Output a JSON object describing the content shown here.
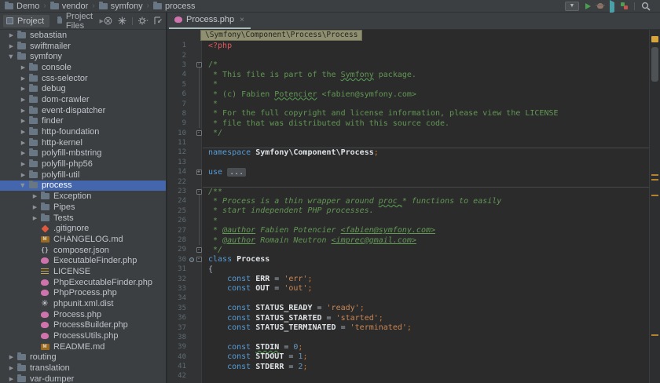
{
  "colors": {
    "selection": "#4466ad",
    "tab_underline": "#a8babb",
    "warning_stripe": "#b5832f",
    "inspection_indicator": "#d9a63d",
    "editor_bg": "#2b2b2b",
    "panel_bg": "#3c3f41"
  },
  "toolbar": {
    "breadcrumbs": [
      {
        "label": "Demo"
      },
      {
        "label": "vendor"
      },
      {
        "label": "symfony"
      },
      {
        "label": "process"
      }
    ],
    "icons": [
      "window-list-dropdown",
      "run",
      "debug",
      "run-with-coverage",
      "profiler",
      "search"
    ]
  },
  "project_panel": {
    "tab_project": "Project",
    "tab_project_files": "Project Files",
    "header_icons": [
      "collapse-all",
      "locate",
      "settings",
      "hide"
    ],
    "tree": [
      {
        "label": "sebastian",
        "type": "folder",
        "depth": 1,
        "arrow": "collapsed"
      },
      {
        "label": "swiftmailer",
        "type": "folder",
        "depth": 1,
        "arrow": "collapsed"
      },
      {
        "label": "symfony",
        "type": "folder",
        "depth": 1,
        "arrow": "expanded"
      },
      {
        "label": "console",
        "type": "folder",
        "depth": 2,
        "arrow": "collapsed"
      },
      {
        "label": "css-selector",
        "type": "folder",
        "depth": 2,
        "arrow": "collapsed"
      },
      {
        "label": "debug",
        "type": "folder",
        "depth": 2,
        "arrow": "collapsed"
      },
      {
        "label": "dom-crawler",
        "type": "folder",
        "depth": 2,
        "arrow": "collapsed"
      },
      {
        "label": "event-dispatcher",
        "type": "folder",
        "depth": 2,
        "arrow": "collapsed"
      },
      {
        "label": "finder",
        "type": "folder",
        "depth": 2,
        "arrow": "collapsed"
      },
      {
        "label": "http-foundation",
        "type": "folder",
        "depth": 2,
        "arrow": "collapsed"
      },
      {
        "label": "http-kernel",
        "type": "folder",
        "depth": 2,
        "arrow": "collapsed"
      },
      {
        "label": "polyfill-mbstring",
        "type": "folder",
        "depth": 2,
        "arrow": "collapsed"
      },
      {
        "label": "polyfill-php56",
        "type": "folder",
        "depth": 2,
        "arrow": "collapsed"
      },
      {
        "label": "polyfill-util",
        "type": "folder",
        "depth": 2,
        "arrow": "collapsed"
      },
      {
        "label": "process",
        "type": "folder",
        "depth": 2,
        "arrow": "expanded",
        "selected": true
      },
      {
        "label": "Exception",
        "type": "folder",
        "depth": 3,
        "arrow": "collapsed"
      },
      {
        "label": "Pipes",
        "type": "folder",
        "depth": 3,
        "arrow": "collapsed"
      },
      {
        "label": "Tests",
        "type": "folder",
        "depth": 3,
        "arrow": "collapsed"
      },
      {
        "label": ".gitignore",
        "type": "git",
        "depth": 3
      },
      {
        "label": "CHANGELOG.md",
        "type": "md",
        "depth": 3
      },
      {
        "label": "composer.json",
        "type": "json",
        "depth": 3
      },
      {
        "label": "ExecutableFinder.php",
        "type": "php",
        "depth": 3
      },
      {
        "label": "LICENSE",
        "type": "license",
        "depth": 3
      },
      {
        "label": "PhpExecutableFinder.php",
        "type": "php",
        "depth": 3
      },
      {
        "label": "PhpProcess.php",
        "type": "php",
        "depth": 3
      },
      {
        "label": "phpunit.xml.dist",
        "type": "xml",
        "depth": 3
      },
      {
        "label": "Process.php",
        "type": "php",
        "depth": 3
      },
      {
        "label": "ProcessBuilder.php",
        "type": "php",
        "depth": 3
      },
      {
        "label": "ProcessUtils.php",
        "type": "php",
        "depth": 3
      },
      {
        "label": "README.md",
        "type": "md",
        "depth": 3
      },
      {
        "label": "routing",
        "type": "folder",
        "depth": 1,
        "arrow": "collapsed"
      },
      {
        "label": "translation",
        "type": "folder",
        "depth": 1,
        "arrow": "collapsed"
      },
      {
        "label": "var-dumper",
        "type": "folder",
        "depth": 1,
        "arrow": "collapsed"
      }
    ]
  },
  "editor": {
    "tab": {
      "label": "Process.php",
      "close": "×"
    },
    "context": "\\Symfony\\Component\\Process\\Process",
    "lines": [
      {
        "num": "1",
        "segs": [
          {
            "t": "<?php",
            "c": "php"
          }
        ]
      },
      {
        "num": "2",
        "segs": []
      },
      {
        "num": "3",
        "fold": "-",
        "segs": [
          {
            "t": "/*",
            "c": "cmt"
          }
        ]
      },
      {
        "num": "4",
        "segs": [
          {
            "t": " * This file is part of the ",
            "c": "cmt"
          },
          {
            "t": "Symfony",
            "c": "cmt",
            "w": 1
          },
          {
            "t": " package.",
            "c": "cmt"
          }
        ]
      },
      {
        "num": "5",
        "segs": [
          {
            "t": " *",
            "c": "cmt"
          }
        ]
      },
      {
        "num": "6",
        "segs": [
          {
            "t": " * (c) Fabien ",
            "c": "cmt"
          },
          {
            "t": "Potencier",
            "c": "cmt",
            "w": 1
          },
          {
            "t": " <fabien@symfony.com>",
            "c": "cmt"
          }
        ]
      },
      {
        "num": "7",
        "segs": [
          {
            "t": " *",
            "c": "cmt"
          }
        ]
      },
      {
        "num": "8",
        "segs": [
          {
            "t": " * For the full copyright and license information, please view the LICENSE",
            "c": "cmt"
          }
        ]
      },
      {
        "num": "9",
        "segs": [
          {
            "t": " * file that was distributed with this source code.",
            "c": "cmt"
          }
        ]
      },
      {
        "num": "10",
        "fold": "-",
        "segs": [
          {
            "t": " */",
            "c": "cmt"
          }
        ]
      },
      {
        "num": "11",
        "segs": [],
        "sep_below": true
      },
      {
        "num": "12",
        "segs": [
          {
            "t": "namespace ",
            "c": "kw"
          },
          {
            "t": "Symfony\\Component\\Process",
            "c": "ns"
          },
          {
            "t": ";",
            "c": "semi"
          }
        ]
      },
      {
        "num": "13",
        "segs": []
      },
      {
        "num": "14",
        "fold": "+",
        "segs": [
          {
            "t": "use ",
            "c": "kw"
          },
          {
            "t": "...",
            "c": "fold"
          }
        ]
      },
      {
        "num": "22",
        "segs": [],
        "sep_below": true
      },
      {
        "num": "23",
        "fold": "-",
        "segs": [
          {
            "t": "/**",
            "c": "doc"
          }
        ]
      },
      {
        "num": "24",
        "segs": [
          {
            "t": " * Process is a thin wrapper around ",
            "c": "doc"
          },
          {
            "t": "proc_",
            "c": "doc",
            "w": 1
          },
          {
            "t": "* functions to easily",
            "c": "doc"
          }
        ]
      },
      {
        "num": "25",
        "segs": [
          {
            "t": " * start independent PHP processes.",
            "c": "doc"
          }
        ]
      },
      {
        "num": "26",
        "segs": [
          {
            "t": " *",
            "c": "doc"
          }
        ]
      },
      {
        "num": "27",
        "segs": [
          {
            "t": " * ",
            "c": "doc"
          },
          {
            "t": "@author",
            "c": "doc",
            "u": 1
          },
          {
            "t": " Fabien Potencier ",
            "c": "doc"
          },
          {
            "t": "<fabien@symfony.com>",
            "c": "doc",
            "u": 1
          }
        ]
      },
      {
        "num": "28",
        "segs": [
          {
            "t": " * ",
            "c": "doc"
          },
          {
            "t": "@author",
            "c": "doc",
            "u": 1
          },
          {
            "t": " Romain Neutron ",
            "c": "doc"
          },
          {
            "t": "<imprec@gmail.com>",
            "c": "doc",
            "u": 1
          }
        ]
      },
      {
        "num": "29",
        "fold": "-",
        "segs": [
          {
            "t": " */",
            "c": "doc"
          }
        ]
      },
      {
        "num": "30",
        "fold": "-",
        "icon": "class",
        "segs": [
          {
            "t": "class ",
            "c": "kw"
          },
          {
            "t": "Process",
            "c": "ns"
          }
        ]
      },
      {
        "num": "31",
        "segs": [
          {
            "t": "{",
            "c": "pl"
          }
        ]
      },
      {
        "num": "32",
        "segs": [
          {
            "t": "    ",
            "c": "pl"
          },
          {
            "t": "const ",
            "c": "kw"
          },
          {
            "t": "ERR",
            "c": "const"
          },
          {
            "t": " = ",
            "c": "pl"
          },
          {
            "t": "'err'",
            "c": "str"
          },
          {
            "t": ";",
            "c": "semi"
          }
        ]
      },
      {
        "num": "33",
        "segs": [
          {
            "t": "    ",
            "c": "pl"
          },
          {
            "t": "const ",
            "c": "kw"
          },
          {
            "t": "OUT",
            "c": "const"
          },
          {
            "t": " = ",
            "c": "pl"
          },
          {
            "t": "'out'",
            "c": "str"
          },
          {
            "t": ";",
            "c": "semi"
          }
        ]
      },
      {
        "num": "34",
        "segs": []
      },
      {
        "num": "35",
        "segs": [
          {
            "t": "    ",
            "c": "pl"
          },
          {
            "t": "const ",
            "c": "kw"
          },
          {
            "t": "STATUS_READY",
            "c": "const"
          },
          {
            "t": " = ",
            "c": "pl"
          },
          {
            "t": "'ready'",
            "c": "str"
          },
          {
            "t": ";",
            "c": "semi"
          }
        ]
      },
      {
        "num": "36",
        "segs": [
          {
            "t": "    ",
            "c": "pl"
          },
          {
            "t": "const ",
            "c": "kw"
          },
          {
            "t": "STATUS_STARTED",
            "c": "const"
          },
          {
            "t": " = ",
            "c": "pl"
          },
          {
            "t": "'started'",
            "c": "str"
          },
          {
            "t": ";",
            "c": "semi"
          }
        ]
      },
      {
        "num": "37",
        "segs": [
          {
            "t": "    ",
            "c": "pl"
          },
          {
            "t": "const ",
            "c": "kw"
          },
          {
            "t": "STATUS_TERMINATED",
            "c": "const"
          },
          {
            "t": " = ",
            "c": "pl"
          },
          {
            "t": "'terminated'",
            "c": "str"
          },
          {
            "t": ";",
            "c": "semi"
          }
        ]
      },
      {
        "num": "38",
        "segs": []
      },
      {
        "num": "39",
        "segs": [
          {
            "t": "    ",
            "c": "pl"
          },
          {
            "t": "const ",
            "c": "kw"
          },
          {
            "t": "STDIN",
            "c": "const",
            "w": 1
          },
          {
            "t": " = ",
            "c": "pl"
          },
          {
            "t": "0",
            "c": "num"
          },
          {
            "t": ";",
            "c": "semi"
          }
        ]
      },
      {
        "num": "40",
        "segs": [
          {
            "t": "    ",
            "c": "pl"
          },
          {
            "t": "const ",
            "c": "kw"
          },
          {
            "t": "STDOUT",
            "c": "const"
          },
          {
            "t": " = ",
            "c": "pl"
          },
          {
            "t": "1",
            "c": "num"
          },
          {
            "t": ";",
            "c": "semi"
          }
        ]
      },
      {
        "num": "41",
        "segs": [
          {
            "t": "    ",
            "c": "pl"
          },
          {
            "t": "const ",
            "c": "kw"
          },
          {
            "t": "STDERR",
            "c": "const"
          },
          {
            "t": " = ",
            "c": "pl"
          },
          {
            "t": "2",
            "c": "num"
          },
          {
            "t": ";",
            "c": "semi"
          }
        ]
      },
      {
        "num": "42",
        "segs": []
      }
    ]
  }
}
